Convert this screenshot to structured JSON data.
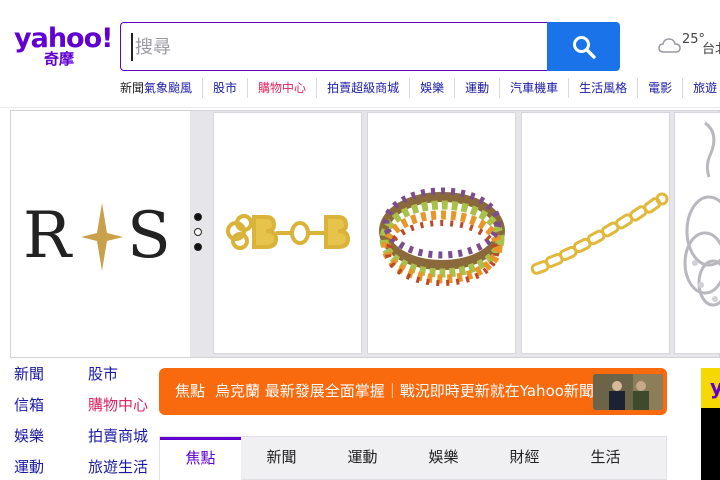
{
  "header": {
    "logo_main": "yahoo!",
    "logo_sub": "奇摩",
    "search_placeholder": "搜尋",
    "weather_temp": "25°",
    "weather_city": "台北"
  },
  "nav": {
    "items": [
      {
        "prefix": "新聞",
        "label": "氣象颱風",
        "hot": false
      },
      {
        "label": "股市",
        "hot": false
      },
      {
        "label": "購物中心",
        "hot": true
      },
      {
        "label": "拍賣超級商城",
        "hot": false
      },
      {
        "label": "娛樂",
        "hot": false
      },
      {
        "label": "運動",
        "hot": false
      },
      {
        "label": "汽車機車",
        "hot": false
      },
      {
        "label": "生活風格",
        "hot": false
      },
      {
        "label": "電影",
        "hot": false
      },
      {
        "label": "旅遊",
        "hot": false
      }
    ]
  },
  "carousel": {
    "brand_left": "R",
    "brand_right": "S",
    "products": [
      {
        "name": "gold-letter-bracelet"
      },
      {
        "name": "gemstone-wrap-bracelet"
      },
      {
        "name": "gold-link-bracelet"
      },
      {
        "name": "silver-knot-earrings"
      }
    ]
  },
  "links": [
    {
      "a": "新聞",
      "b": "股市",
      "b_hot": false
    },
    {
      "a": "信箱",
      "b": "購物中心",
      "b_hot": true
    },
    {
      "a": "娛樂",
      "b": "拍賣商城",
      "b_hot": false
    },
    {
      "a": "運動",
      "b": "旅遊生活",
      "b_hot": false
    }
  ],
  "promo": {
    "tag": "焦點",
    "text": "烏克蘭 最新發展全面掌握｜戰況即時更新就在Yahoo新聞專題報導"
  },
  "tabs": [
    {
      "label": "焦點",
      "active": true
    },
    {
      "label": "新聞",
      "active": false
    },
    {
      "label": "運動",
      "active": false
    },
    {
      "label": "娛樂",
      "active": false
    },
    {
      "label": "財經",
      "active": false
    },
    {
      "label": "生活",
      "active": false
    }
  ],
  "colors": {
    "brand": "#6001d2",
    "search_button": "#1a73e8",
    "promo": "#f9690e",
    "hot_link": "#e0245e"
  }
}
